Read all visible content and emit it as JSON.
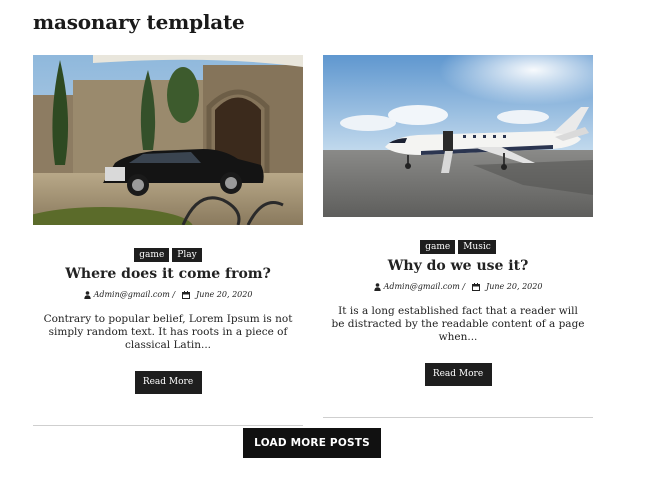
{
  "page": {
    "title": "masonary template",
    "load_more_label": "LOAD MORE POSTS"
  },
  "posts": [
    {
      "image_alt": "Black luxury car parked in front of a stone building",
      "tags": [
        "game",
        "Play"
      ],
      "title": "Where does it come from?",
      "author": "Admin@gmail.com /",
      "date": "June 20, 2020",
      "excerpt": "Contrary to popular belief, Lorem Ipsum is not simply random text. It has roots in a piece of classical Latin...",
      "read_more_label": "Read More",
      "author_icon": "user-icon",
      "date_icon": "calendar-icon"
    },
    {
      "image_alt": "Private jet parked on a runway",
      "tags": [
        "game",
        "Music"
      ],
      "title": "Why do we use it?",
      "author": "Admin@gmail.com /",
      "date": "June 20, 2020",
      "excerpt": "It is a long established fact that a reader will be distracted by the readable content of a page when...",
      "read_more_label": "Read More",
      "author_icon": "user-icon",
      "date_icon": "calendar-icon"
    }
  ],
  "colors": {
    "tag_bg": "#1e1e1e",
    "button_bg": "#1e1e1e",
    "load_more_bg": "#111111",
    "divider": "#cfcfcf"
  }
}
